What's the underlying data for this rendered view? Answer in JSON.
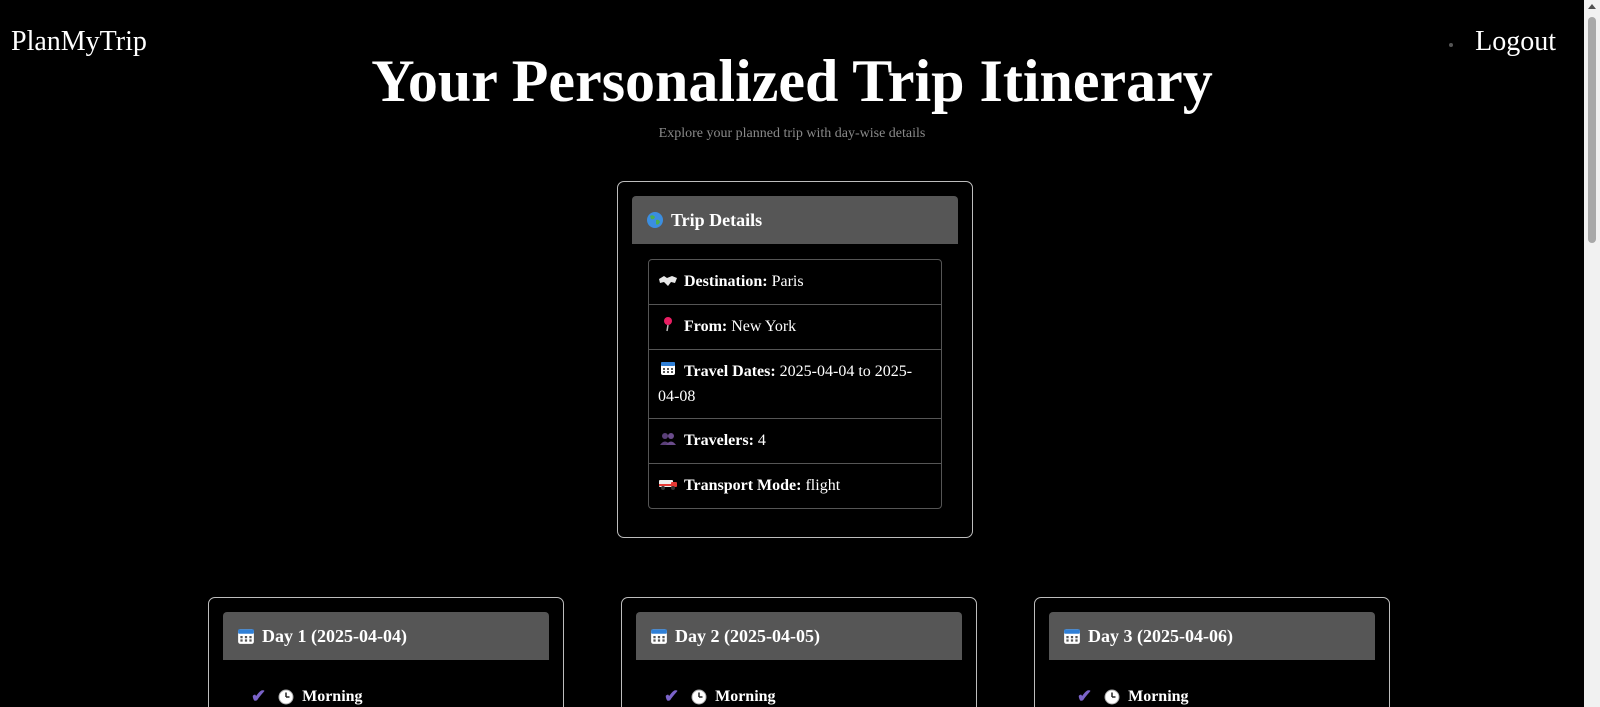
{
  "nav": {
    "brand": "PlanMyTrip",
    "logout_label": "Logout"
  },
  "header": {
    "title": "Your Personalized Trip Itinerary",
    "subtitle": "Explore your planned trip with day-wise details"
  },
  "trip": {
    "header_icon": "globe-icon",
    "header_label": "Trip Details",
    "rows": [
      {
        "icon": "map-icon",
        "label": "Destination:",
        "value": "Paris"
      },
      {
        "icon": "pin-icon",
        "label": "From:",
        "value": "New York"
      },
      {
        "icon": "calendar-icon",
        "label": "Travel Dates:",
        "value": "2025-04-04 to 2025-04-08"
      },
      {
        "icon": "people-icon",
        "label": "Travelers:",
        "value": "4"
      },
      {
        "icon": "vehicle-icon",
        "label": "Transport Mode:",
        "value": "flight"
      }
    ]
  },
  "days": [
    {
      "title": "Day 1 (2025-04-04)",
      "first_slot": "Morning"
    },
    {
      "title": "Day 2 (2025-04-05)",
      "first_slot": "Morning"
    },
    {
      "title": "Day 3 (2025-04-06)",
      "first_slot": "Morning"
    }
  ],
  "colors": {
    "background": "#000000",
    "card_header": "#565656",
    "card_border": "#bdbdbd",
    "check": "#7b63c9",
    "subtitle": "#8a8a8a"
  }
}
